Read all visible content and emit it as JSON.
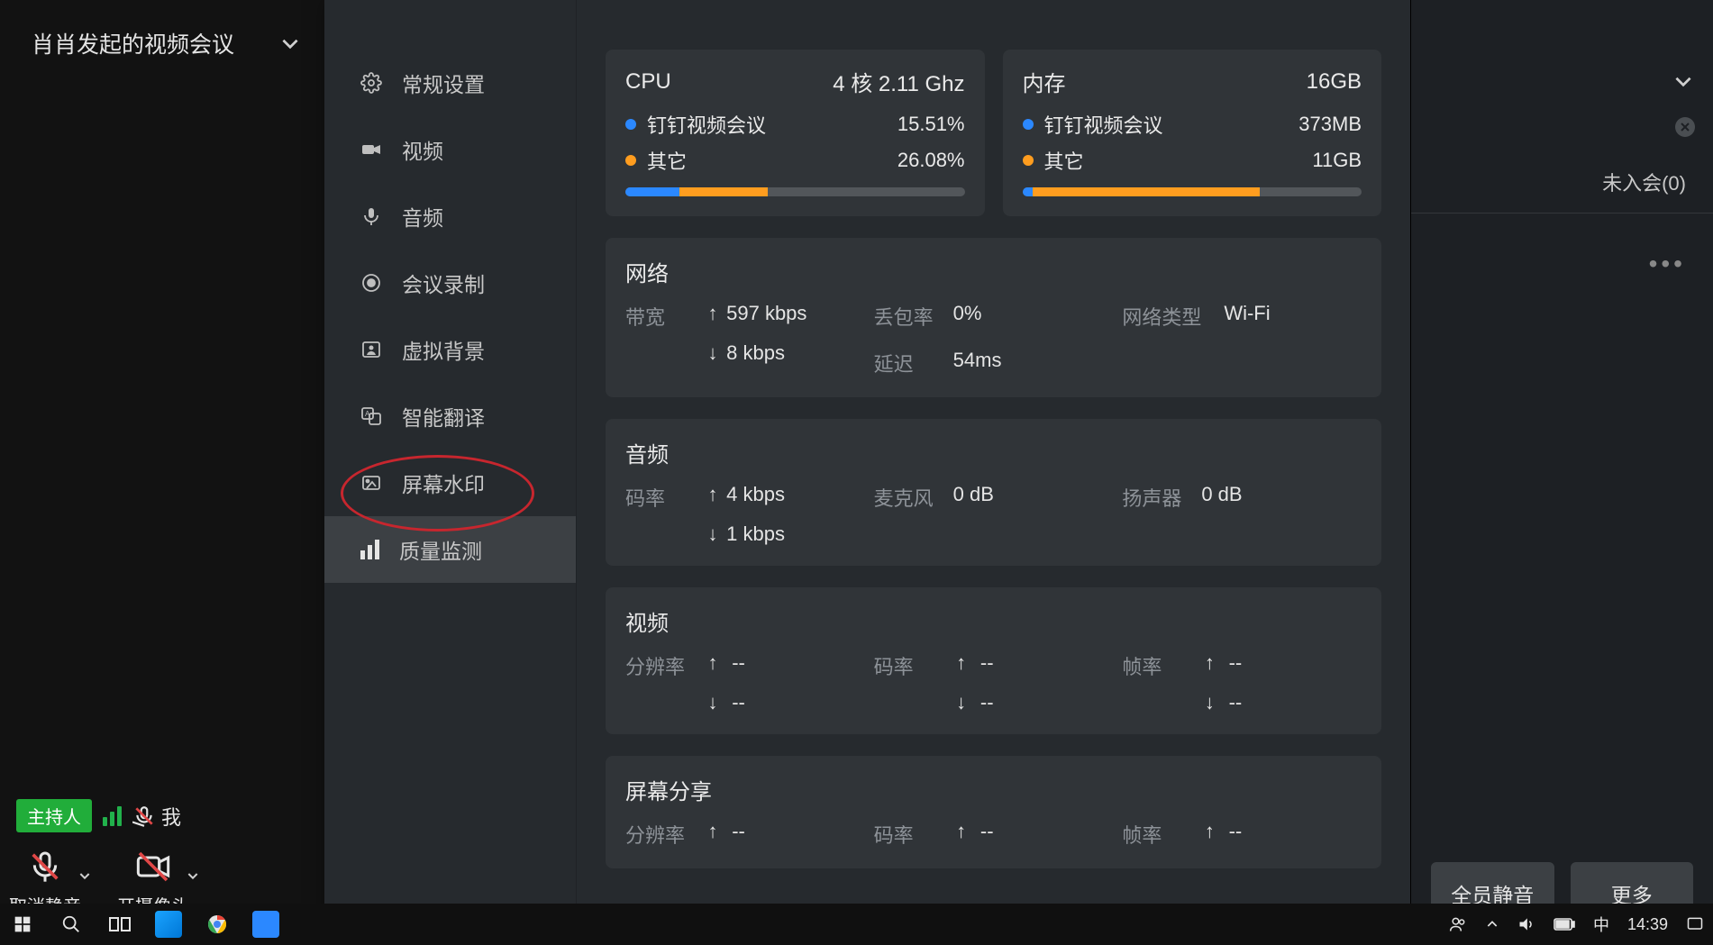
{
  "meeting": {
    "title": "肖肖发起的视频会议"
  },
  "participant": {
    "host_badge": "主持人",
    "self_label": "我"
  },
  "toolbar": {
    "unmute": "取消静音",
    "camera_on": "开摄像头"
  },
  "settings_nav": {
    "general": "常规设置",
    "video": "视频",
    "audio": "音频",
    "recording": "会议录制",
    "virtual_bg": "虚拟背景",
    "translate": "智能翻译",
    "watermark": "屏幕水印",
    "quality": "质量监测"
  },
  "cpu": {
    "title": "CPU",
    "spec": "4 核 2.11 Ghz",
    "app_label": "钉钉视频会议",
    "app_pct": "15.51%",
    "other_label": "其它",
    "other_pct": "26.08%",
    "bar_app_width": "16%",
    "bar_other_width": "26%"
  },
  "mem": {
    "title": "内存",
    "spec": "16GB",
    "app_label": "钉钉视频会议",
    "app_val": "373MB",
    "other_label": "其它",
    "other_val": "11GB",
    "bar_app_width": "3%",
    "bar_other_width": "67%"
  },
  "network": {
    "title": "网络",
    "bandwidth_label": "带宽",
    "bw_up": "597 kbps",
    "bw_down": "8 kbps",
    "loss_label": "丢包率",
    "loss_val": "0%",
    "latency_label": "延迟",
    "latency_val": "54ms",
    "type_label": "网络类型",
    "type_val": "Wi-Fi"
  },
  "audio": {
    "title": "音频",
    "bitrate_label": "码率",
    "br_up": "4 kbps",
    "br_down": "1 kbps",
    "mic_label": "麦克风",
    "mic_val": "0 dB",
    "speaker_label": "扬声器",
    "speaker_val": "0 dB"
  },
  "video": {
    "title": "视频",
    "res_label": "分辨率",
    "res_up": "--",
    "res_down": "--",
    "br_label": "码率",
    "br_up": "--",
    "br_down": "--",
    "fps_label": "帧率",
    "fps_up": "--",
    "fps_down": "--"
  },
  "share": {
    "title": "屏幕分享",
    "res_label": "分辨率",
    "res_up": "--",
    "br_label": "码率",
    "br_up": "--",
    "fps_label": "帧率",
    "fps_up": "--"
  },
  "right": {
    "tab_not_joined": "未入会(0)",
    "mute_all": "全员静音",
    "more": "更多"
  },
  "taskbar": {
    "clock": "14:39"
  }
}
